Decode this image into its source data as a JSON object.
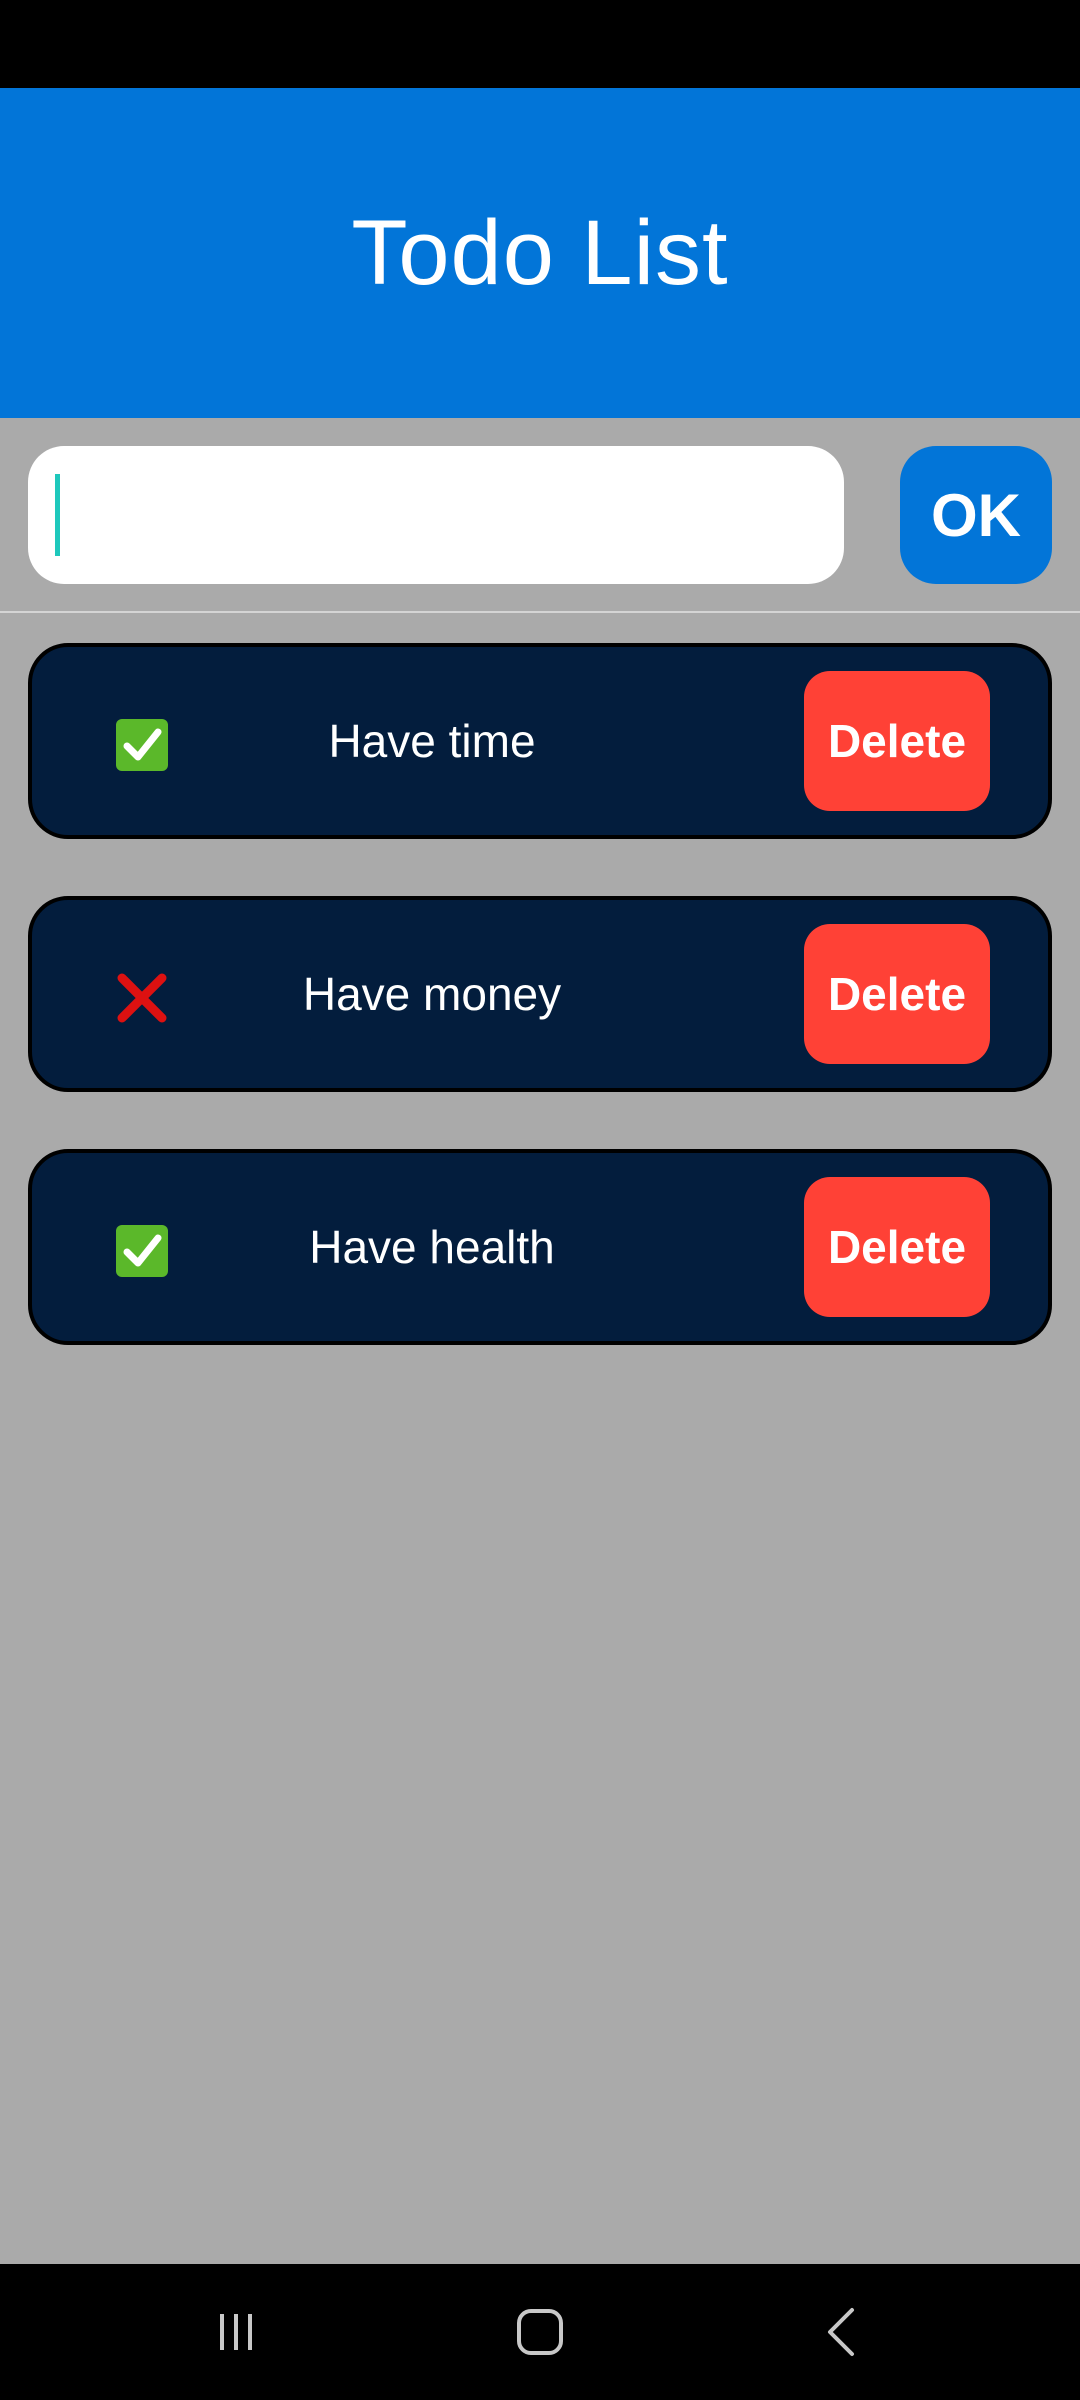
{
  "app": {
    "title": "Todo List"
  },
  "input": {
    "value": "",
    "placeholder": "",
    "ok_label": "OK"
  },
  "todos": [
    {
      "text": "Have time",
      "done": true,
      "status_icon": "check-mark-icon",
      "delete_label": "Delete"
    },
    {
      "text": "Have money",
      "done": false,
      "status_icon": "cross-mark-icon",
      "delete_label": "Delete"
    },
    {
      "text": "Have health",
      "done": true,
      "status_icon": "check-mark-icon",
      "delete_label": "Delete"
    }
  ],
  "nav": {
    "recents_icon": "recents-icon",
    "home_icon": "home-icon",
    "back_icon": "back-icon"
  },
  "colors": {
    "header": "#0275d8",
    "background": "#aaaaaa",
    "item_background": "#031d3d",
    "delete": "#ff4136",
    "ok": "#0275d8",
    "done": "#5bb82a",
    "not_done": "#dd1111"
  }
}
